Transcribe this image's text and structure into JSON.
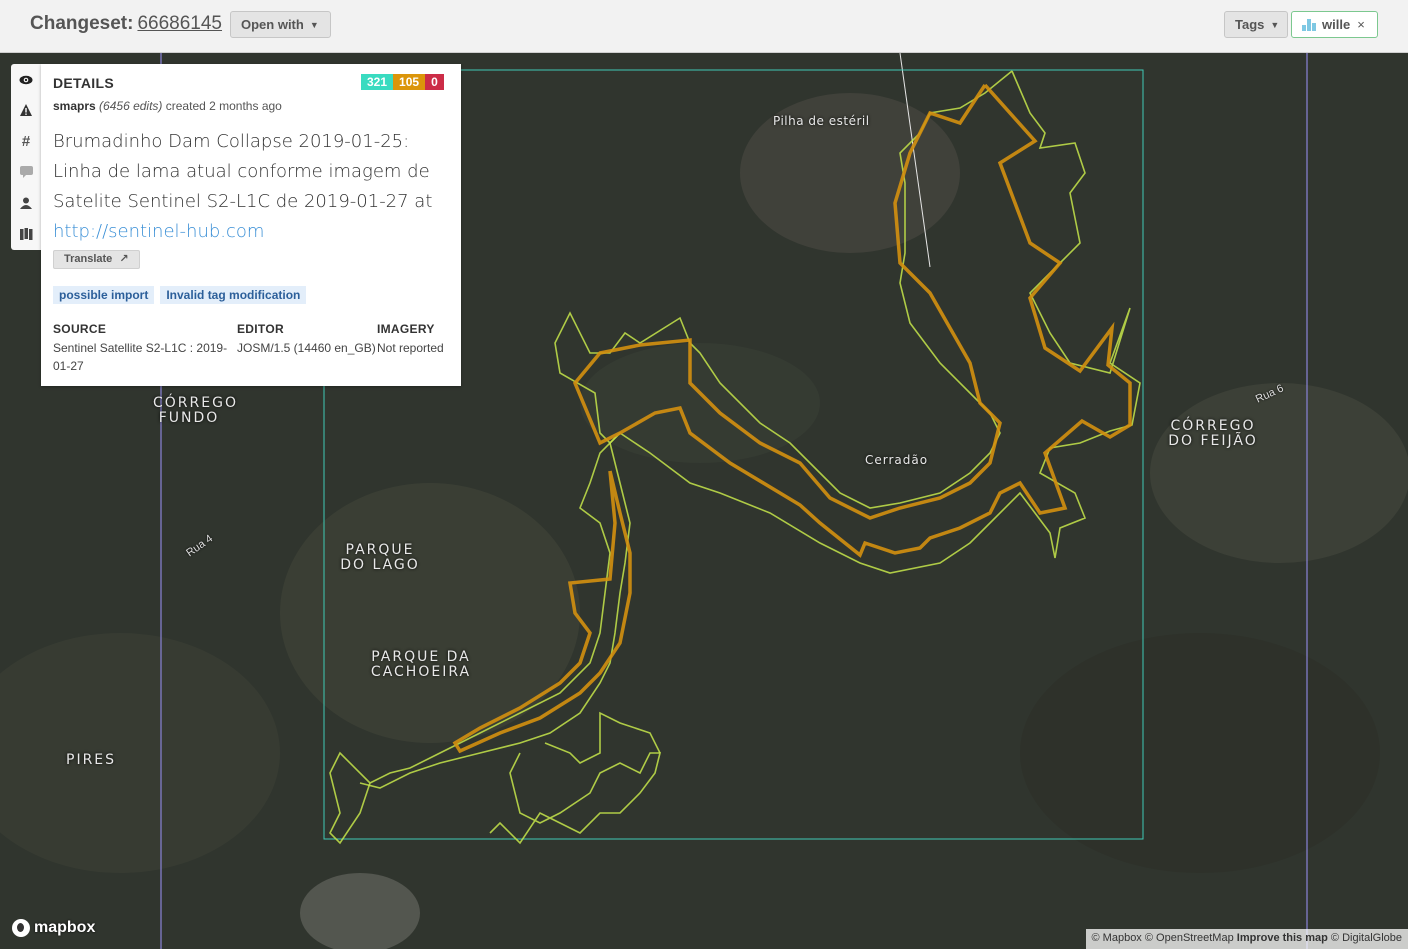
{
  "header": {
    "title_prefix": "Changeset:",
    "changeset_id": "66686145",
    "open_with_label": "Open with",
    "tags_label": "Tags",
    "user_filter_label": "wille",
    "user_filter_close": "×"
  },
  "details": {
    "heading": "DETAILS",
    "counts": {
      "create": "321",
      "modify": "105",
      "delete": "0"
    },
    "user": "smaprs",
    "edits": "(6456 edits)",
    "created": "created 2 months ago",
    "comment_text": "Brumadinho Dam Collapse 2019-01-25: Linha de lama atual conforme imagem de Satelite Sentinel S2-L1C de 2019-01-27 at",
    "comment_link": "http://sentinel-hub.com",
    "translate_label": "Translate",
    "flags": [
      "possible import",
      "Invalid tag modification"
    ],
    "source_label": "SOURCE",
    "source_value": "Sentinel Satellite S2-L1C : 2019-01-27",
    "editor_label": "EDITOR",
    "editor_value": "JOSM/1.5 (14460 en_GB)",
    "imagery_label": "IMAGERY",
    "imagery_value": "Not reported"
  },
  "side_tabs": [
    "eye-icon",
    "warning-icon",
    "hash-icon",
    "comment-icon",
    "user-icon",
    "map-icon"
  ],
  "map": {
    "places": {
      "pilha": "Pilha de estéril",
      "cerradao": "Cerradão",
      "corrego_fundo": "CÓRREGO FUNDO",
      "parque_lago": "PARQUE DO LAGO",
      "parque_cachoeira": "PARQUE DA CACHOEIRA",
      "pires": "PIRES",
      "corrego_feijao": "CÓRREGO DO FEIJÃO"
    },
    "roads": {
      "rua4": "Rua 4",
      "rua6": "Rua 6"
    },
    "logo": "mapbox",
    "attribution": {
      "mapbox": "© Mapbox",
      "osm": "© OpenStreetMap",
      "improve": "Improve this map",
      "imagery": "© DigitalGlobe"
    },
    "colors": {
      "added": "#c6e54a",
      "modified": "#d4900f",
      "bbox": "#3fc9b5",
      "county_line": "#8a83d8"
    }
  }
}
